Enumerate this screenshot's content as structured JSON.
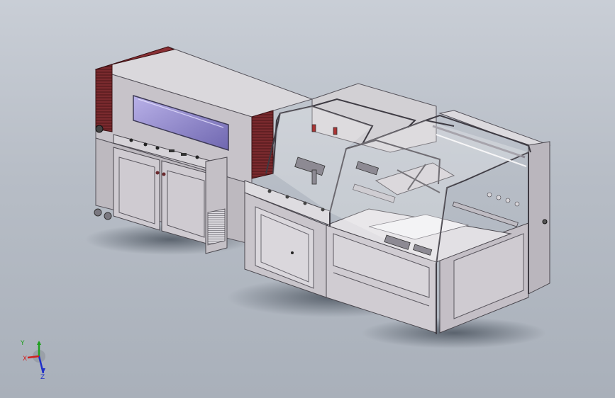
{
  "viewport": {
    "background": "#b7bdc6",
    "model": "shrink-wrap-packaging-machine"
  },
  "colors": {
    "frame": "#d7d5d8",
    "panel": "#c9c6cc",
    "window": "#8f88c8",
    "heater_red": "#7a2a2e",
    "shadow": "#55606a"
  },
  "triad": {
    "x_label": "X",
    "y_label": "Y",
    "z_label": "Z",
    "x_color": "#d11f1f",
    "y_color": "#1fa01f",
    "z_color": "#2030c8"
  }
}
